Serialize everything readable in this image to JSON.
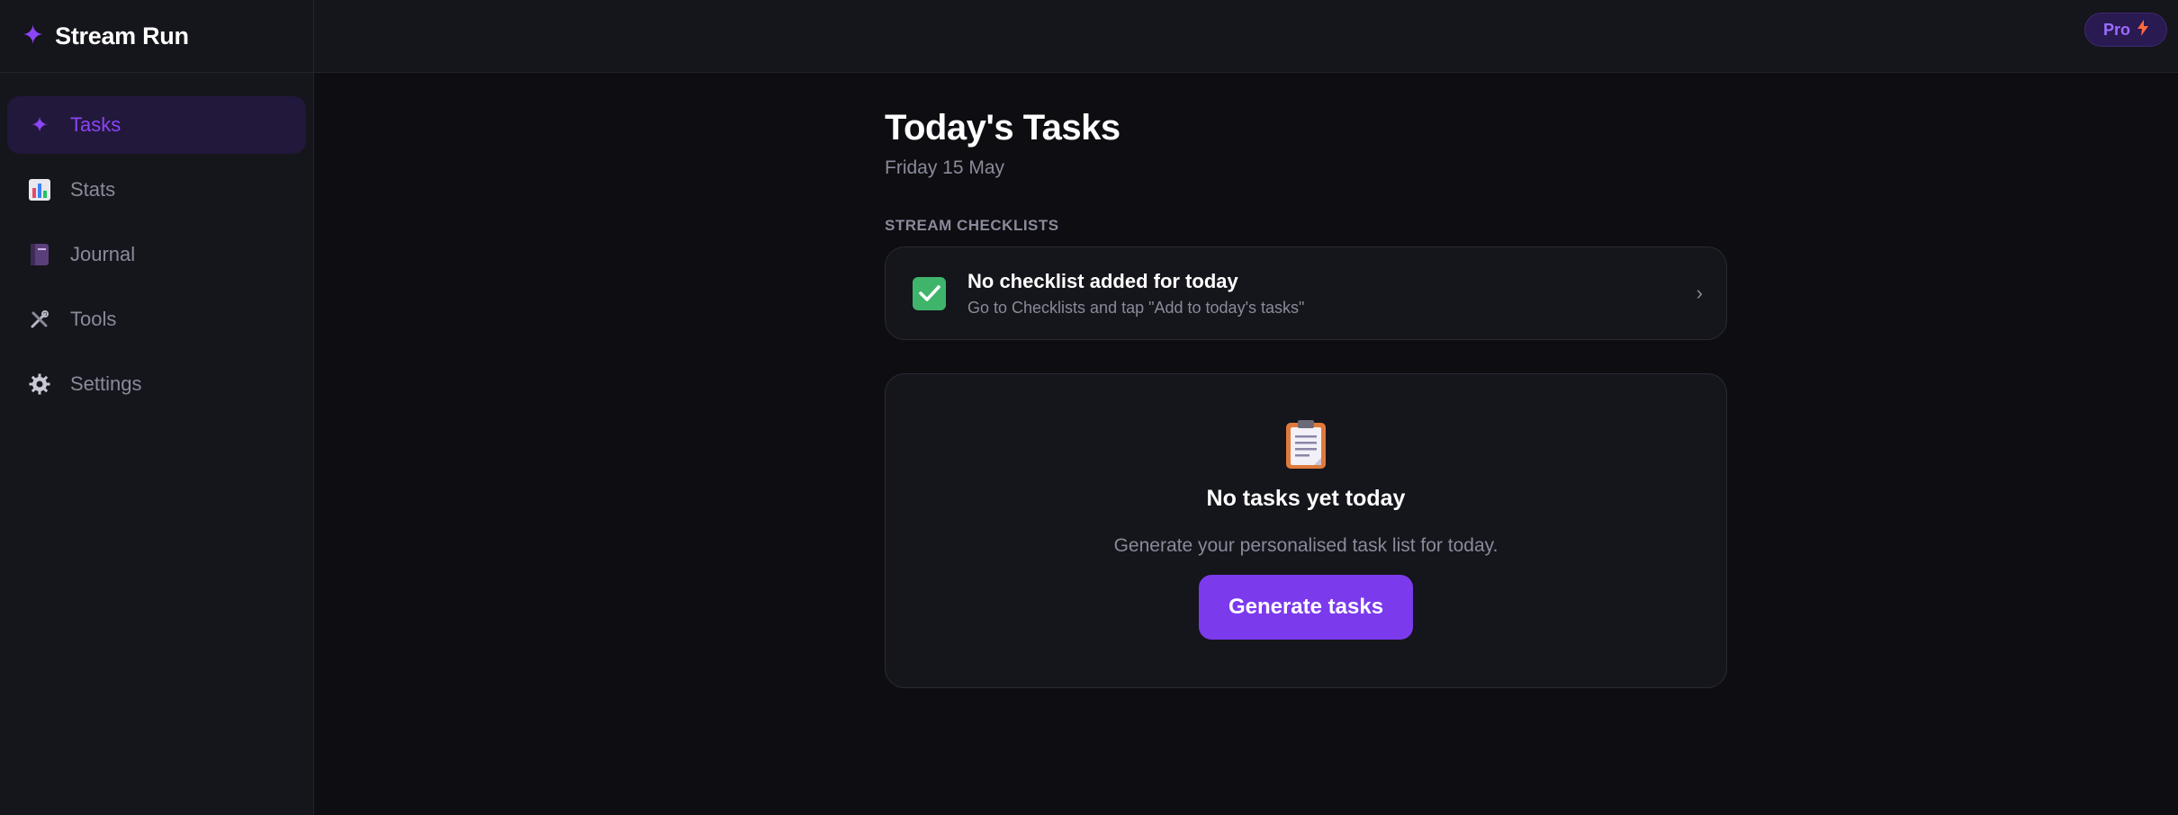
{
  "app": {
    "name": "Stream Run"
  },
  "sidebar": {
    "items": [
      {
        "label": "Tasks",
        "icon": "sparkle-icon",
        "active": true
      },
      {
        "label": "Stats",
        "icon": "bar-chart-icon"
      },
      {
        "label": "Journal",
        "icon": "notebook-icon"
      },
      {
        "label": "Tools",
        "icon": "tools-icon"
      },
      {
        "label": "Settings",
        "icon": "gear-icon"
      }
    ]
  },
  "topbar": {
    "pro_label": "Pro"
  },
  "main": {
    "title": "Today's Tasks",
    "date": "Friday 15 May",
    "section_label": "STREAM CHECKLISTS",
    "checklist": {
      "title": "No checklist added for today",
      "subtitle": "Go to Checklists and tap \"Add to today's tasks\""
    },
    "empty": {
      "title": "No tasks yet today",
      "subtitle": "Generate your personalised task list for today.",
      "button_label": "Generate tasks"
    }
  },
  "colors": {
    "accent": "#7c3aed",
    "accent_text": "#8b45f5",
    "background": "#0d0d12",
    "panel": "#15151c",
    "check_green": "#3fb56b",
    "bolt": "#ff6a3d"
  }
}
